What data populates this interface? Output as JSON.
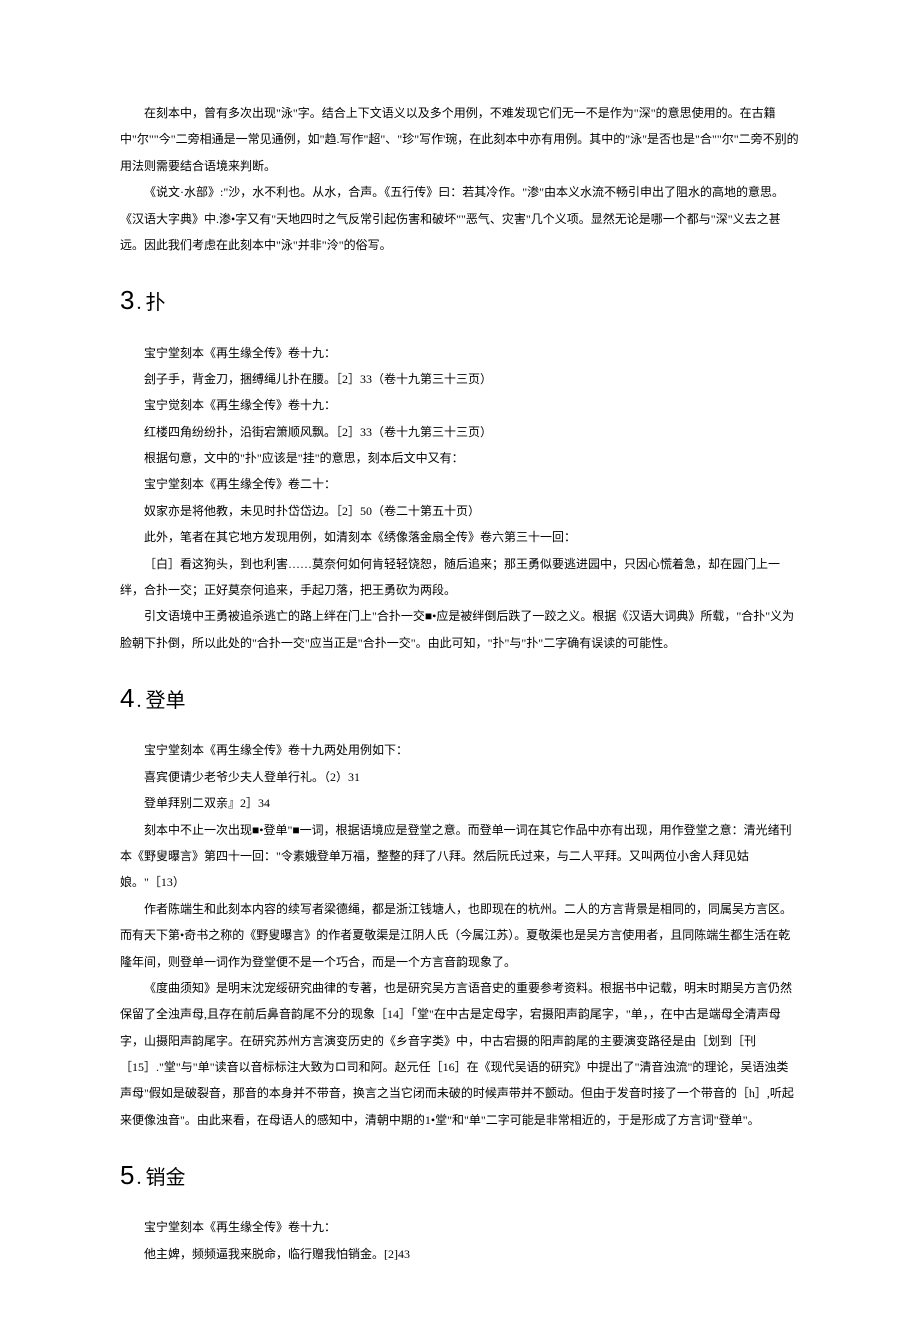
{
  "intro": {
    "p1": "在刻本中，曾有多次出现\"泳\"字。结合上下文语义以及多个用例，不难发现它们无一不是作为\"深\"的意思使用的。在古籍中\"尔\"\"今\"二旁相通是一常见通例，如\"趋.写作\"超\"、\"珍\"写作'琬，在此刻本中亦有用例。其中的\"泳\"是否也是\"合\"\"尔\"二旁不别的用法则需要结合语境来判断。",
    "p2": "《说文·水部》:\"沙，水不利也。从水，合声。《五行传》曰：若其冷作。\"渗\"由本义水流不畅引申出了阻水的高地的意思。《汉语大字典》中.渗•字又有\"天地四时之气反常引起伤害和破坏\"\"恶气、灾害\"几个义项。显然无论是哪一个都与\"深\"义去之甚远。因此我们考虑在此刻本中\"泳\"并非\"泠\"的俗写。"
  },
  "sec3": {
    "num": "3",
    "title": "扑",
    "p1": "宝宁堂刻本《再生缘全传》卷十九：",
    "p2": "刽子手，背金刀，捆缚绳儿扑在腰。［2］33（卷十九第三十三页）",
    "p3": "宝宁觉刻本《再生缘全传》卷十九：",
    "p4": "红楼四角纷纷扑，沿街宕箫顺风飘。［2］33（卷十九第三十三页）",
    "p5": "根据句意，文中的\"扑\"应该是\"挂\"的意思，刻本后文中又有：",
    "p6": "宝宁堂刻本《再生缘全传》卷二十：",
    "p7": "奴家亦是将他教，未见时扑岱岱边。［2］50（卷二十第五十页）",
    "p8": "此外，笔者在其它地方发现用例，如清刻本《绣像落金扇全传》卷六第三十一回：",
    "p9": "［白］看这狗头，到也利害……莫奈何如何肯轻轻饶恕，随后追来；那王勇似要逃进园中，只因心慌着急，却在园门上一绊，合扑一交；正好莫奈何追来，手起刀落，把王勇砍为两段。",
    "p10": "引文语境中王勇被追杀逃亡的路上绊在门上\"合扑一交■•应是被绊倒后跌了一跤之义。根据《汉语大词典》所载，\"合扑\"义为脸朝下扑倒，所以此处的\"合扑一交\"应当正是\"合扑一交\"。由此可知，\"扑\"与\"扑\"二字确有误读的可能性。"
  },
  "sec4": {
    "num": "4",
    "title": "登单",
    "p1": "宝宁堂刻本《再生缘全传》卷十九两处用例如下：",
    "p2": "喜宾便请少老爷少夫人登单行礼。（2）31",
    "p3": "登单拜别二双亲』2］34",
    "p4": "刻本中不止一次出现■•登单\"■一词，根据语境应是登堂之意。而登单一词在其它作品中亦有出现，用作登堂之意：清光绪刊本《野叟曝言》第四十一回：\"令素娥登单万福，整整的拜了八拜。然后阮氏过来，与二人平拜。又叫两位小舍人拜见姑娘。\"［13）",
    "p5": "作者陈端生和此刻本内容的续写者梁德绳，都是浙江钱塘人，也即现在的杭州。二人的方言背景是相同的，同属吴方言区。而有天下第•奇书之称的《野叟曝言》的作者夏敬渠是江阴人氏（今属江苏）。夏敬渠也是吴方言使用者，且同陈端生都生活在乾隆年间，则登单一词作为登堂便不是一个巧合，而是一个方言音韵现象了。",
    "p6": "《度曲须知》是明末沈宠绥研究曲律的专著，也是研究吴方言语音史的重要参考资料。根据书中记载，明末时期吴方言仍然保留了全浊声母,且存在前后鼻音韵尾不分的现象［14］「堂\"在中古是定母字，宕摄阳声韵尾字，\"单，，在中古是端母全清声母字，山摄阳声韵尾字。在研究苏州方言演变历史的《乡音字类》中，中古宕摄的阳声韵尾的主要演变路径是由［划到［刊［15］.\"堂\"与\"单\"读音以音标标注大致为ロ司和阿。赵元任［16］在《现代吴语的研究》中提出了\"清音浊流\"的理论，吴语浊类声母\"假如是破裂音，那音的本身并不带音，换言之当它闭而未破的时候声带并不颤动。但由于发音时接了一个带音的［h］,听起来便像浊音\"。由此来看，在母语人的感知中，清朝中期的1•堂\"和\"单\"二字可能是非常相近的，于是形成了方言词\"登单\"。"
  },
  "sec5": {
    "num": "5",
    "title": "销金",
    "p1": "宝宁堂刻本《再生缘全传》卷十九：",
    "p2": "他主婢，频频逼我来脱命，临行赠我怕销金。[2]43"
  }
}
